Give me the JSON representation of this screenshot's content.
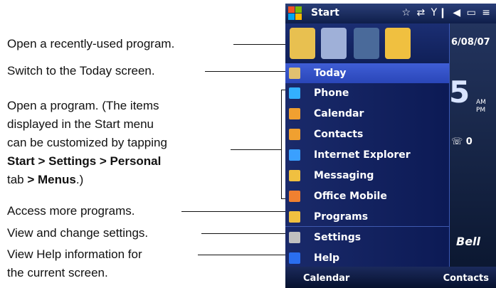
{
  "annotations": {
    "recent": "Open a recently-used program.",
    "today": "Switch to the Today screen.",
    "open_line1": "Open a program. (The items",
    "open_line2": "displayed in the Start menu",
    "open_line3": "can be customized by tapping",
    "open_line4_bold": "Start > Settings > Personal",
    "open_line5_bold1": "tab",
    "open_line5_bold2": "> Menus",
    "open_line5_end": ".)",
    "more": "Access more programs.",
    "settings": "View and change settings.",
    "help_line1": "View Help information for",
    "help_line2": "the current screen."
  },
  "phone": {
    "title": "Start",
    "status_icons": "☆ ⇄ Y❙ ◀ ▭ ≡",
    "date": "6/08/07",
    "clock_digit": "5",
    "ampm_top": "AM",
    "ampm_bottom": "PM",
    "missed_calls": "0",
    "brand": "Bell",
    "menu_items": [
      {
        "label": "Today",
        "icon": "home-icon",
        "color": "#e0c070"
      },
      {
        "label": "Phone",
        "icon": "phone-icon",
        "color": "#33b0ff"
      },
      {
        "label": "Calendar",
        "icon": "calendar-icon",
        "color": "#f0a030"
      },
      {
        "label": "Contacts",
        "icon": "contacts-icon",
        "color": "#f0a030"
      },
      {
        "label": "Internet Explorer",
        "icon": "ie-icon",
        "color": "#3aa0ff"
      },
      {
        "label": "Messaging",
        "icon": "envelope-icon",
        "color": "#f0c040"
      },
      {
        "label": "Office Mobile",
        "icon": "office-icon",
        "color": "#f08030"
      },
      {
        "label": "Programs",
        "icon": "folder-icon",
        "color": "#f0c040"
      },
      {
        "label": "Settings",
        "icon": "settings-icon",
        "color": "#c0c0c0"
      },
      {
        "label": "Help",
        "icon": "help-icon",
        "color": "#2a6ef0"
      }
    ],
    "softkeys": {
      "left": "Calendar",
      "right": "Contacts"
    }
  }
}
